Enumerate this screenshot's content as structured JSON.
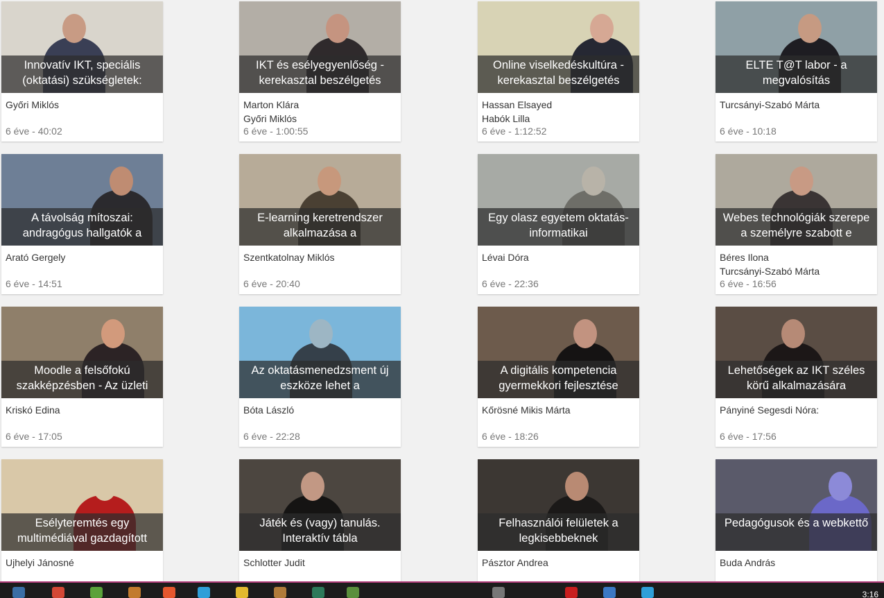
{
  "cards": [
    {
      "title": [
        "Innovatív IKT, speciális",
        "(oktatási) szükségletek:"
      ],
      "authors": [
        "Győri Miklós",
        ""
      ],
      "age": "6 éve - 40:02",
      "bg": "#d9d5cc",
      "fig": "#3a3f55",
      "head": "#c89b84"
    },
    {
      "title": [
        "IKT és esélyegyenlőség -",
        "kerekasztal beszélgetés"
      ],
      "authors": [
        "Marton Klára",
        "Győri Miklós"
      ],
      "age": "6 éve - 1:00:55",
      "bg": "#b3aea6",
      "fig": "#2f2a2c",
      "head": "#c59480"
    },
    {
      "title": [
        "Online viselkedéskultúra -",
        "kerekasztal beszélgetés"
      ],
      "authors": [
        "Hassan Elsayed",
        "Habók Lilla"
      ],
      "age": "6 éve - 1:12:52",
      "bg": "#d8d3b5",
      "fig": "#262833",
      "head": "#d6a894"
    },
    {
      "title": [
        "ELTE T@T labor - a",
        "megvalósítás"
      ],
      "authors": [
        "Turcsányi-Szabó Márta",
        ""
      ],
      "age": "6 éve - 10:18",
      "bg": "#8fa0a6",
      "fig": "#1e1d22",
      "head": "#c69a82"
    },
    {
      "title": [
        "A távolság mítoszai:",
        "andragógus hallgatók a"
      ],
      "authors": [
        "Arató Gergely",
        ""
      ],
      "age": "6 éve - 14:51",
      "bg": "#6e7f96",
      "fig": "#2b2a2e",
      "head": "#bf8c72"
    },
    {
      "title": [
        "E-learning keretrendszer",
        "alkalmazása a"
      ],
      "authors": [
        "Szentkatolnay Miklós",
        ""
      ],
      "age": "6 éve - 20:40",
      "bg": "#b7ab98",
      "fig": "#4a4033",
      "head": "#c7987c"
    },
    {
      "title": [
        "Egy olasz egyetem oktatás-",
        "informatikai"
      ],
      "authors": [
        "Lévai Dóra",
        ""
      ],
      "age": "6 éve - 22:36",
      "bg": "#a7aaa5",
      "fig": "#6e6e68",
      "head": "#b8b3a8"
    },
    {
      "title": [
        "Webes technológiák szerepe",
        "a személyre szabott e"
      ],
      "authors": [
        "Béres Ilona",
        "Turcsányi-Szabó Márta"
      ],
      "age": "6 éve - 16:56",
      "bg": "#aea99d",
      "fig": "#3a3434",
      "head": "#c89a84"
    },
    {
      "title": [
        "Moodle a felsőfokú",
        "szakképzésben - Az üzleti"
      ],
      "authors": [
        "Kriskó Edina",
        ""
      ],
      "age": "6 éve - 17:05",
      "bg": "#8f7f6a",
      "fig": "#2c2325",
      "head": "#d29a7c"
    },
    {
      "title": [
        "Az oktatásmenedzsment új",
        "eszköze lehet a"
      ],
      "authors": [
        "Bóta László",
        ""
      ],
      "age": "6 éve - 22:28",
      "bg": "#7bb6da",
      "fig": "#35404a",
      "head": "#9db6c4"
    },
    {
      "title": [
        "A digitális kompetencia",
        "gyermekkori fejlesztése"
      ],
      "authors": [
        "Kőrösné Mikis Márta",
        ""
      ],
      "age": "6 éve - 18:26",
      "bg": "#6d5b4c",
      "fig": "#151313",
      "head": "#c29380"
    },
    {
      "title": [
        "Lehetőségek az IKT széles",
        "körű alkalmazására"
      ],
      "authors": [
        "Pányiné Segesdi Nóra:",
        ""
      ],
      "age": "6 éve - 17:56",
      "bg": "#5a4d44",
      "fig": "#1c1717",
      "head": "#b68a76"
    },
    {
      "title": [
        "Esélyteremtés egy",
        "multimédiával gazdagított"
      ],
      "authors": [
        "Ujhelyi Jánosné",
        ""
      ],
      "age": "",
      "bg": "#d9c8a8",
      "fig": "#b51d1d",
      "head": "#d9c8a8"
    },
    {
      "title": [
        "Játék és (vagy) tanulás.",
        "Interaktív tábla"
      ],
      "authors": [
        "Schlotter Judit",
        ""
      ],
      "age": "",
      "bg": "#4c4640",
      "fig": "#151413",
      "head": "#c29884"
    },
    {
      "title": [
        "Felhasználói felületek a",
        "legkisebbeknek"
      ],
      "authors": [
        "Pásztor Andrea",
        ""
      ],
      "age": "",
      "bg": "#3c3733",
      "fig": "#1b1918",
      "head": "#b98a73"
    },
    {
      "title": [
        "Pedagógusok és a webkettő",
        ""
      ],
      "authors": [
        "Buda András",
        ""
      ],
      "age": "",
      "bg": "#5a5a6a",
      "fig": "#6b68c8",
      "head": "#8c8ad8"
    }
  ],
  "taskbar": {
    "clock": "3:16",
    "icons": [
      "#3a6ea5",
      "#d34836",
      "#5aa23a",
      "#c27b2d",
      "#e4572e",
      "#2f9fd8",
      "#e2b92f",
      "#b07b3a",
      "#2d7a5a",
      "#5a8f3c",
      "#777777",
      "#c81e1e",
      "#3b78c4",
      "#2f9fd8"
    ]
  }
}
